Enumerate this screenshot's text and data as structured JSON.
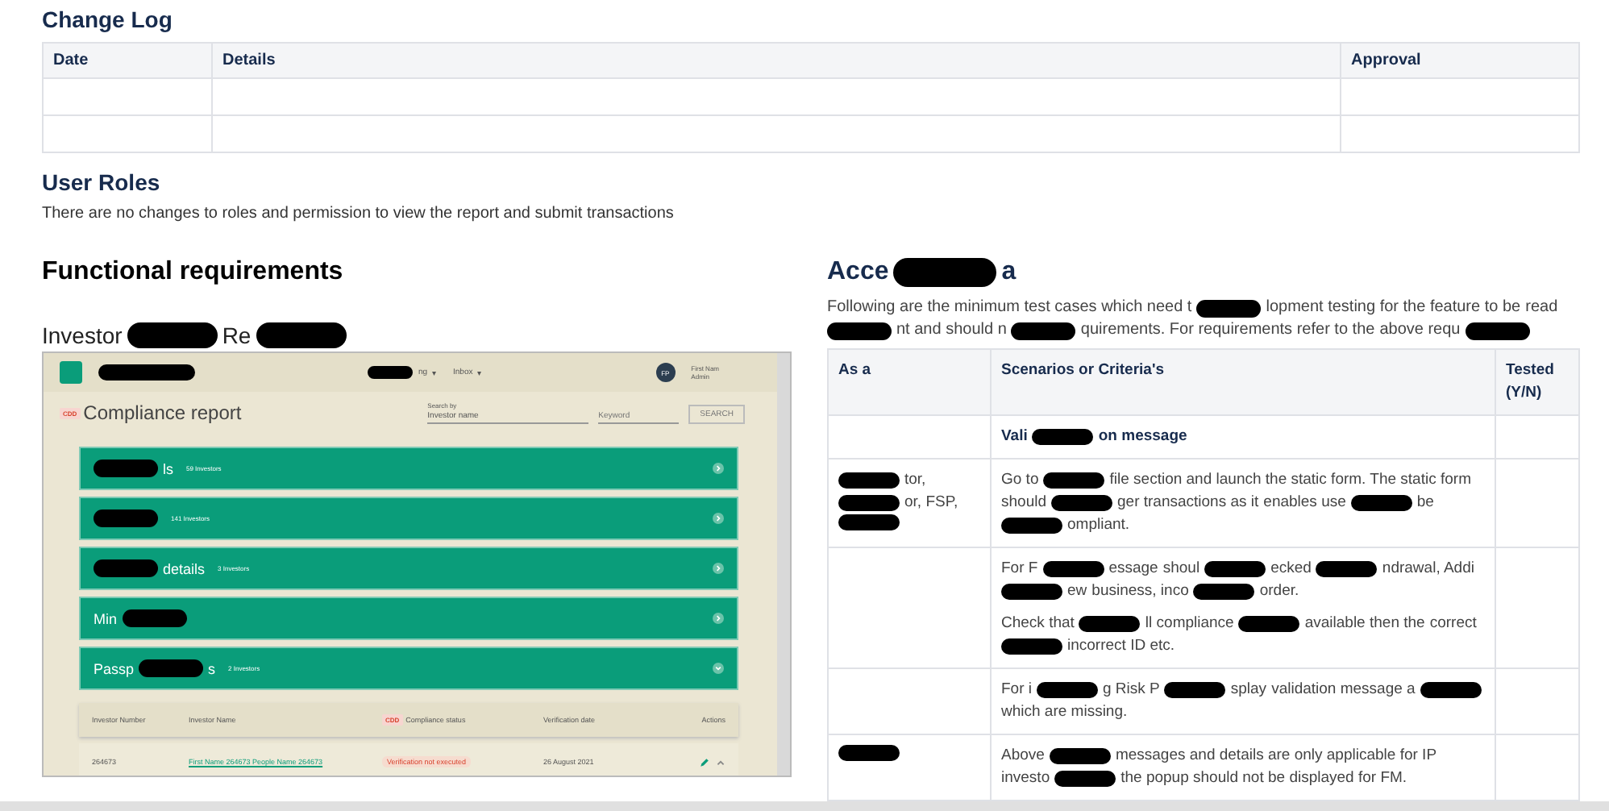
{
  "change_log": {
    "title": "Change Log",
    "columns": [
      "Date",
      "Details",
      "Approval"
    ],
    "rows": [
      {},
      {}
    ]
  },
  "user_roles": {
    "title": "User Roles",
    "text": "There are no changes to roles and permission to view the report and submit transactions"
  },
  "functional": {
    "title": "Functional requirements",
    "subtitle": [
      {
        "kind": "text",
        "text": "Investor"
      },
      {
        "kind": "redaction"
      },
      {
        "kind": "text",
        "text": "Re"
      },
      {
        "kind": "redaction"
      }
    ],
    "screenshot": {
      "nav": [
        {
          "parts": [
            {
              "kind": "redaction"
            },
            {
              "kind": "text",
              "text": "ng"
            }
          ],
          "caret": "▾"
        },
        {
          "parts": [
            {
              "kind": "text",
              "text": "Inbox"
            }
          ],
          "caret": "▾"
        }
      ],
      "user": {
        "initials": "FP",
        "name": "First Nam",
        "role": "Admin"
      },
      "tag": "CDD",
      "page_title": "Compliance report",
      "search": {
        "label": "Search by",
        "field": "Investor name",
        "placeholder": "Keyword",
        "button": "SEARCH"
      },
      "groups": [
        {
          "name": [
            {
              "kind": "redaction"
            },
            {
              "kind": "text",
              "text": "ls"
            }
          ],
          "count": "59 Investors",
          "expanded": false
        },
        {
          "name": [
            {
              "kind": "redaction"
            }
          ],
          "count": "141 Investors",
          "expanded": false
        },
        {
          "name": [
            {
              "kind": "redaction"
            },
            {
              "kind": "text",
              "text": "details"
            }
          ],
          "count": "3 Investors",
          "expanded": false
        },
        {
          "name": [
            {
              "kind": "text",
              "text": "Min"
            },
            {
              "kind": "redaction"
            }
          ],
          "expanded": false
        },
        {
          "name": [
            {
              "kind": "text",
              "text": "Passp"
            },
            {
              "kind": "redaction"
            },
            {
              "kind": "text",
              "text": "s"
            }
          ],
          "count": "2 Investors",
          "expanded": true
        }
      ],
      "table": {
        "columns": [
          {
            "label": "Investor Number"
          },
          {
            "label": "Investor Name"
          },
          {
            "label": "Compliance status",
            "tag": "CDD"
          },
          {
            "label": "Verification date"
          },
          {
            "label": "Actions"
          }
        ],
        "rows": [
          {
            "number": "264673",
            "name": "First Name 264673 People Name 264673",
            "status": "Verification not executed",
            "date": "26 August 2021"
          }
        ]
      }
    }
  },
  "acceptance": {
    "title": [
      {
        "kind": "text",
        "text": "Acce"
      },
      {
        "kind": "redaction"
      },
      {
        "kind": "text",
        "text": "a"
      }
    ],
    "intro": [
      {
        "kind": "text",
        "text": "Following are the minimum test cases which need t"
      },
      {
        "kind": "redaction"
      },
      {
        "kind": "text",
        "text": "lopment testing for the feature to be"
      },
      {
        "kind": "text",
        "text": "read"
      },
      {
        "kind": "redaction"
      },
      {
        "kind": "text",
        "text": "nt and should n"
      },
      {
        "kind": "redaction"
      },
      {
        "kind": "text",
        "text": "quirements. For requirements refer to the"
      },
      {
        "kind": "text",
        "text": "above requ"
      },
      {
        "kind": "redaction"
      }
    ],
    "columns": [
      "As a",
      "Scenarios or Criteria's",
      "Tested (Y/N)"
    ],
    "rows": [
      {
        "criteria": [
          {
            "bold": true,
            "parts": [
              {
                "kind": "text",
                "text": "Vali"
              },
              {
                "kind": "redaction"
              },
              {
                "kind": "text",
                "text": "on message"
              }
            ]
          }
        ]
      },
      {
        "as": [
          {
            "kind": "redaction"
          },
          {
            "kind": "text",
            "text": "tor,"
          },
          {
            "kind": "redaction"
          },
          {
            "kind": "text",
            "text": "or, FSP,"
          },
          {
            "kind": "redaction"
          }
        ],
        "criteria": [
          {
            "bold": false,
            "parts": [
              {
                "kind": "text",
                "text": "Go to"
              },
              {
                "kind": "redaction"
              },
              {
                "kind": "text",
                "text": "file section and launch the static form. The static form"
              },
              {
                "kind": "text",
                "text": "should"
              },
              {
                "kind": "redaction"
              },
              {
                "kind": "text",
                "text": "ger transactions as it"
              },
              {
                "kind": "text",
                "text": "enables use"
              },
              {
                "kind": "redaction"
              },
              {
                "kind": "text",
                "text": "be"
              },
              {
                "kind": "redaction"
              },
              {
                "kind": "text",
                "text": "ompliant."
              }
            ]
          }
        ]
      },
      {
        "criteria": [
          {
            "bold": false,
            "parts": [
              {
                "kind": "text",
                "text": "For F"
              },
              {
                "kind": "redaction"
              },
              {
                "kind": "text",
                "text": "essage"
              },
              {
                "kind": "text",
                "text": "shoul"
              },
              {
                "kind": "redaction"
              },
              {
                "kind": "text",
                "text": "ecked"
              },
              {
                "kind": "redaction"
              },
              {
                "kind": "text",
                "text": "ndrawal, Addi"
              },
              {
                "kind": "redaction"
              },
              {
                "kind": "text",
                "text": "ew"
              },
              {
                "kind": "text",
                "text": "business, inco"
              },
              {
                "kind": "redaction"
              },
              {
                "kind": "text",
                "text": "order."
              }
            ]
          },
          {
            "bold": false,
            "parts": [
              {
                "kind": "text",
                "text": "Check that"
              },
              {
                "kind": "redaction"
              },
              {
                "kind": "text",
                "text": "ll compliance"
              },
              {
                "kind": "redaction"
              },
              {
                "kind": "text",
                "text": "available then the"
              },
              {
                "kind": "text",
                "text": "correct"
              },
              {
                "kind": "redaction"
              },
              {
                "kind": "text",
                "text": "incorrect ID etc."
              }
            ]
          }
        ]
      },
      {
        "criteria": [
          {
            "bold": false,
            "parts": [
              {
                "kind": "text",
                "text": "For i"
              },
              {
                "kind": "redaction"
              },
              {
                "kind": "text",
                "text": "g Risk P"
              },
              {
                "kind": "redaction"
              },
              {
                "kind": "text",
                "text": "splay"
              },
              {
                "kind": "text",
                "text": "validation message a"
              },
              {
                "kind": "redaction"
              },
              {
                "kind": "text",
                "text": "which are missing."
              }
            ]
          }
        ]
      },
      {
        "as": [
          {
            "kind": "redaction"
          }
        ],
        "criteria": [
          {
            "bold": false,
            "parts": [
              {
                "kind": "text",
                "text": "Above"
              },
              {
                "kind": "redaction"
              },
              {
                "kind": "text",
                "text": "messages and details are only applicable for IP"
              },
              {
                "kind": "text",
                "text": "investo"
              },
              {
                "kind": "redaction"
              },
              {
                "kind": "text",
                "text": "the popup should not be displayed for FM."
              }
            ]
          }
        ]
      }
    ]
  }
}
